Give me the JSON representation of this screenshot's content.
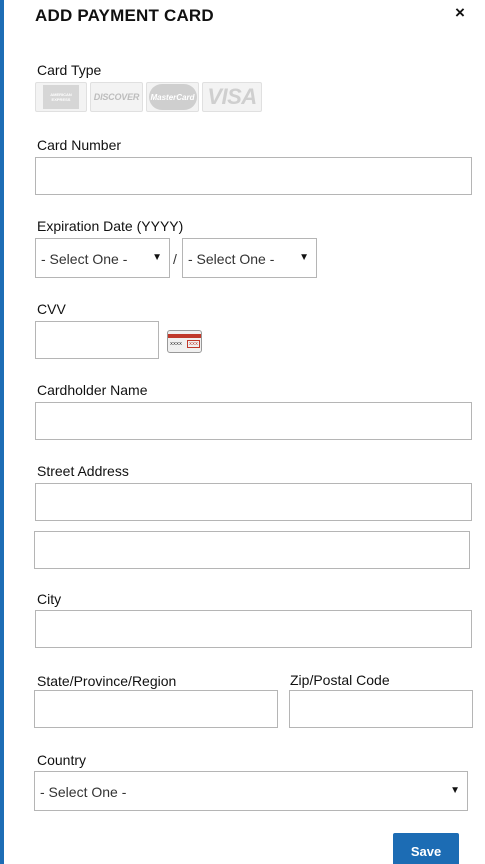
{
  "modal": {
    "title": "ADD PAYMENT CARD",
    "close_label": "×"
  },
  "card_type": {
    "label": "Card Type",
    "logos": [
      {
        "name": "amex",
        "text": "AMERICAN EXPRESS"
      },
      {
        "name": "discover",
        "text": "DISCOVER"
      },
      {
        "name": "mastercard",
        "text": "MasterCard"
      },
      {
        "name": "visa",
        "text": "VISA"
      }
    ]
  },
  "card_number": {
    "label": "Card Number",
    "value": ""
  },
  "expiration": {
    "label": "Expiration Date (YYYY)",
    "month_value": "- Select One -",
    "year_value": "- Select One -",
    "separator": "/"
  },
  "cvv": {
    "label": "CVV",
    "value": "",
    "icon_number": "xxxx",
    "icon_code": "xxx"
  },
  "cardholder": {
    "label": "Cardholder Name",
    "value": ""
  },
  "street": {
    "label": "Street Address",
    "line1": "",
    "line2": ""
  },
  "city": {
    "label": "City",
    "value": ""
  },
  "state": {
    "label": "State/Province/Region",
    "value": ""
  },
  "zip": {
    "label": "Zip/Postal Code",
    "value": ""
  },
  "country": {
    "label": "Country",
    "value": "- Select One -"
  },
  "save_label": "Save",
  "colors": {
    "accent": "#1c6cb4",
    "border": "#b5b5b5"
  }
}
